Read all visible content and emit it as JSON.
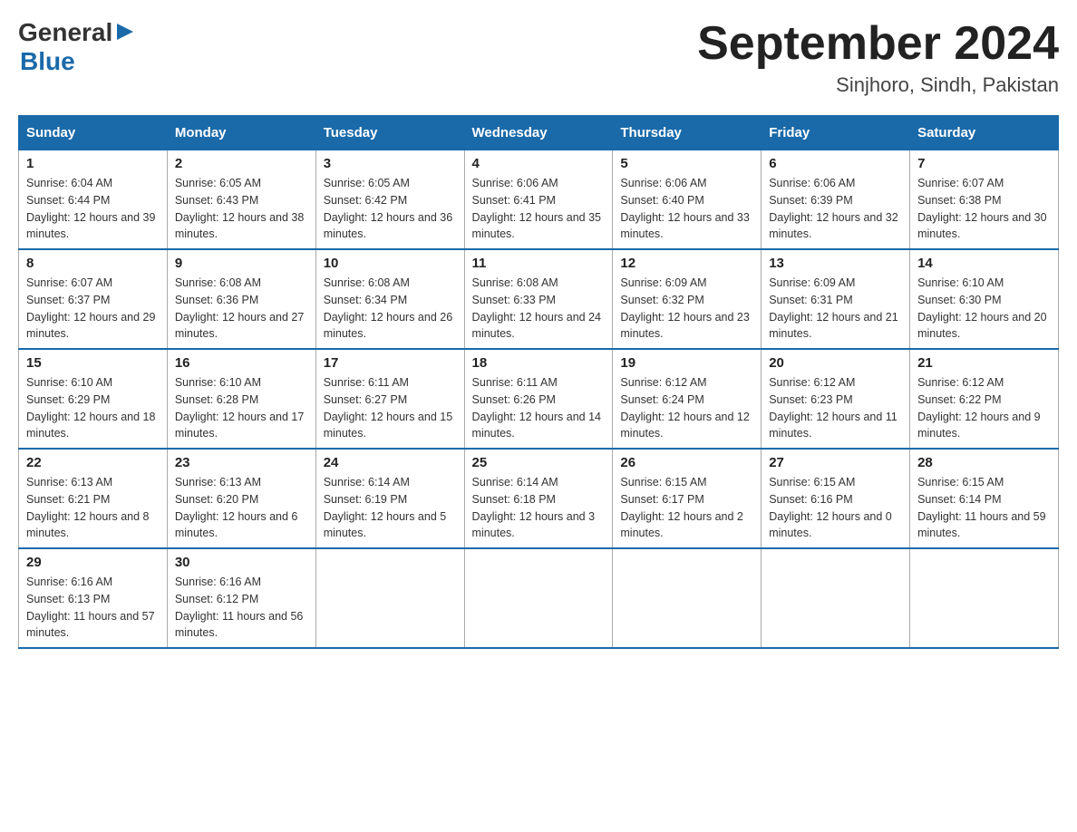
{
  "logo": {
    "general": "General",
    "arrow": "▶",
    "blue": "Blue"
  },
  "title": "September 2024",
  "subtitle": "Sinjhoro, Sindh, Pakistan",
  "headers": [
    "Sunday",
    "Monday",
    "Tuesday",
    "Wednesday",
    "Thursday",
    "Friday",
    "Saturday"
  ],
  "weeks": [
    [
      {
        "day": "1",
        "sunrise": "Sunrise: 6:04 AM",
        "sunset": "Sunset: 6:44 PM",
        "daylight": "Daylight: 12 hours and 39 minutes."
      },
      {
        "day": "2",
        "sunrise": "Sunrise: 6:05 AM",
        "sunset": "Sunset: 6:43 PM",
        "daylight": "Daylight: 12 hours and 38 minutes."
      },
      {
        "day": "3",
        "sunrise": "Sunrise: 6:05 AM",
        "sunset": "Sunset: 6:42 PM",
        "daylight": "Daylight: 12 hours and 36 minutes."
      },
      {
        "day": "4",
        "sunrise": "Sunrise: 6:06 AM",
        "sunset": "Sunset: 6:41 PM",
        "daylight": "Daylight: 12 hours and 35 minutes."
      },
      {
        "day": "5",
        "sunrise": "Sunrise: 6:06 AM",
        "sunset": "Sunset: 6:40 PM",
        "daylight": "Daylight: 12 hours and 33 minutes."
      },
      {
        "day": "6",
        "sunrise": "Sunrise: 6:06 AM",
        "sunset": "Sunset: 6:39 PM",
        "daylight": "Daylight: 12 hours and 32 minutes."
      },
      {
        "day": "7",
        "sunrise": "Sunrise: 6:07 AM",
        "sunset": "Sunset: 6:38 PM",
        "daylight": "Daylight: 12 hours and 30 minutes."
      }
    ],
    [
      {
        "day": "8",
        "sunrise": "Sunrise: 6:07 AM",
        "sunset": "Sunset: 6:37 PM",
        "daylight": "Daylight: 12 hours and 29 minutes."
      },
      {
        "day": "9",
        "sunrise": "Sunrise: 6:08 AM",
        "sunset": "Sunset: 6:36 PM",
        "daylight": "Daylight: 12 hours and 27 minutes."
      },
      {
        "day": "10",
        "sunrise": "Sunrise: 6:08 AM",
        "sunset": "Sunset: 6:34 PM",
        "daylight": "Daylight: 12 hours and 26 minutes."
      },
      {
        "day": "11",
        "sunrise": "Sunrise: 6:08 AM",
        "sunset": "Sunset: 6:33 PM",
        "daylight": "Daylight: 12 hours and 24 minutes."
      },
      {
        "day": "12",
        "sunrise": "Sunrise: 6:09 AM",
        "sunset": "Sunset: 6:32 PM",
        "daylight": "Daylight: 12 hours and 23 minutes."
      },
      {
        "day": "13",
        "sunrise": "Sunrise: 6:09 AM",
        "sunset": "Sunset: 6:31 PM",
        "daylight": "Daylight: 12 hours and 21 minutes."
      },
      {
        "day": "14",
        "sunrise": "Sunrise: 6:10 AM",
        "sunset": "Sunset: 6:30 PM",
        "daylight": "Daylight: 12 hours and 20 minutes."
      }
    ],
    [
      {
        "day": "15",
        "sunrise": "Sunrise: 6:10 AM",
        "sunset": "Sunset: 6:29 PM",
        "daylight": "Daylight: 12 hours and 18 minutes."
      },
      {
        "day": "16",
        "sunrise": "Sunrise: 6:10 AM",
        "sunset": "Sunset: 6:28 PM",
        "daylight": "Daylight: 12 hours and 17 minutes."
      },
      {
        "day": "17",
        "sunrise": "Sunrise: 6:11 AM",
        "sunset": "Sunset: 6:27 PM",
        "daylight": "Daylight: 12 hours and 15 minutes."
      },
      {
        "day": "18",
        "sunrise": "Sunrise: 6:11 AM",
        "sunset": "Sunset: 6:26 PM",
        "daylight": "Daylight: 12 hours and 14 minutes."
      },
      {
        "day": "19",
        "sunrise": "Sunrise: 6:12 AM",
        "sunset": "Sunset: 6:24 PM",
        "daylight": "Daylight: 12 hours and 12 minutes."
      },
      {
        "day": "20",
        "sunrise": "Sunrise: 6:12 AM",
        "sunset": "Sunset: 6:23 PM",
        "daylight": "Daylight: 12 hours and 11 minutes."
      },
      {
        "day": "21",
        "sunrise": "Sunrise: 6:12 AM",
        "sunset": "Sunset: 6:22 PM",
        "daylight": "Daylight: 12 hours and 9 minutes."
      }
    ],
    [
      {
        "day": "22",
        "sunrise": "Sunrise: 6:13 AM",
        "sunset": "Sunset: 6:21 PM",
        "daylight": "Daylight: 12 hours and 8 minutes."
      },
      {
        "day": "23",
        "sunrise": "Sunrise: 6:13 AM",
        "sunset": "Sunset: 6:20 PM",
        "daylight": "Daylight: 12 hours and 6 minutes."
      },
      {
        "day": "24",
        "sunrise": "Sunrise: 6:14 AM",
        "sunset": "Sunset: 6:19 PM",
        "daylight": "Daylight: 12 hours and 5 minutes."
      },
      {
        "day": "25",
        "sunrise": "Sunrise: 6:14 AM",
        "sunset": "Sunset: 6:18 PM",
        "daylight": "Daylight: 12 hours and 3 minutes."
      },
      {
        "day": "26",
        "sunrise": "Sunrise: 6:15 AM",
        "sunset": "Sunset: 6:17 PM",
        "daylight": "Daylight: 12 hours and 2 minutes."
      },
      {
        "day": "27",
        "sunrise": "Sunrise: 6:15 AM",
        "sunset": "Sunset: 6:16 PM",
        "daylight": "Daylight: 12 hours and 0 minutes."
      },
      {
        "day": "28",
        "sunrise": "Sunrise: 6:15 AM",
        "sunset": "Sunset: 6:14 PM",
        "daylight": "Daylight: 11 hours and 59 minutes."
      }
    ],
    [
      {
        "day": "29",
        "sunrise": "Sunrise: 6:16 AM",
        "sunset": "Sunset: 6:13 PM",
        "daylight": "Daylight: 11 hours and 57 minutes."
      },
      {
        "day": "30",
        "sunrise": "Sunrise: 6:16 AM",
        "sunset": "Sunset: 6:12 PM",
        "daylight": "Daylight: 11 hours and 56 minutes."
      },
      null,
      null,
      null,
      null,
      null
    ]
  ]
}
